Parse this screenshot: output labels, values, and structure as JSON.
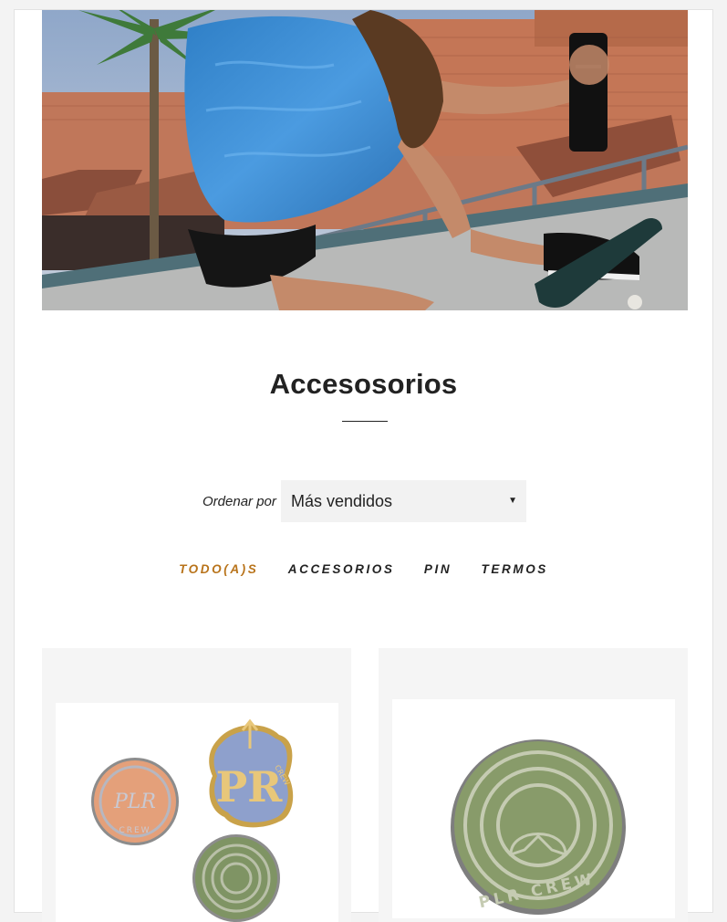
{
  "collection": {
    "title": "Accesosorios"
  },
  "sort": {
    "label": "Ordenar por",
    "selected": "Más vendidos"
  },
  "filters": [
    {
      "label": "TODO(A)S",
      "active": true
    },
    {
      "label": "ACCESORIOS",
      "active": false
    },
    {
      "label": "PIN",
      "active": false
    },
    {
      "label": "TERMOS",
      "active": false
    }
  ],
  "products": [
    {
      "image": "pin-set-plr-crew",
      "logo_text": [
        "PLR",
        "CREW",
        "PR",
        "CREW"
      ]
    },
    {
      "image": "green-pin-plr-crew",
      "logo_text": [
        "PLR CREW"
      ]
    }
  ],
  "colors": {
    "accent": "#b8731a",
    "text": "#222222",
    "card_bg": "#f5f5f5",
    "select_bg": "#f2f2f2"
  }
}
